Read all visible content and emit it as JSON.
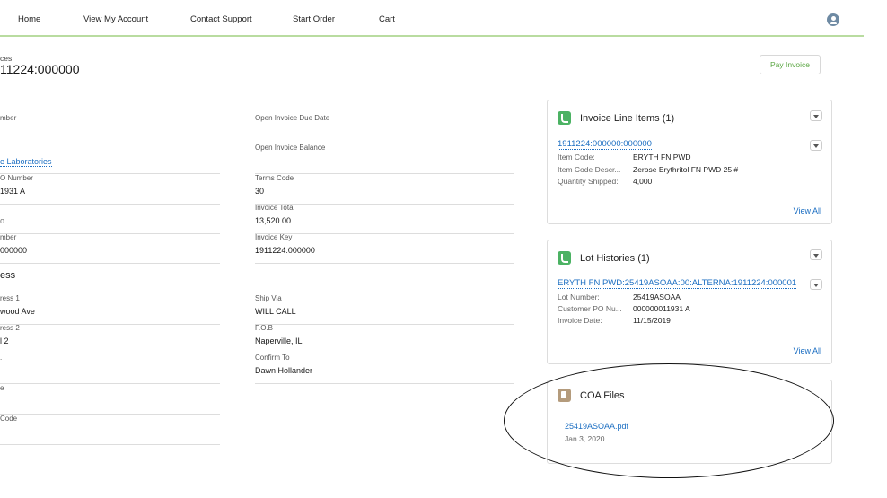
{
  "nav": {
    "items": [
      "Home",
      "View My Account",
      "Contact Support",
      "Start Order",
      "Cart"
    ],
    "avatar_icon": "user-avatar-icon"
  },
  "header": {
    "breadcrumb": "ces",
    "title": "11224:000000",
    "pay_button": "Pay Invoice"
  },
  "left_fields": [
    {
      "label": "mber",
      "value": ""
    },
    {
      "label": "",
      "value": "e Laboratories",
      "link": true
    },
    {
      "label": "O Number",
      "value": "1931 A"
    },
    {
      "label": "",
      "value": "o"
    },
    {
      "label": "mber",
      "value": "000000"
    }
  ],
  "right_fields": [
    {
      "label": "Open Invoice Due Date",
      "value": ""
    },
    {
      "label": "Open Invoice Balance",
      "value": ""
    },
    {
      "label": "Terms Code",
      "value": "30"
    },
    {
      "label": "Invoice Total",
      "value": "13,520.00"
    },
    {
      "label": "Invoice Key",
      "value": "1911224:000000"
    }
  ],
  "section_title": "ess",
  "left_fields2": [
    {
      "label": "ress 1",
      "value": "wood Ave"
    },
    {
      "label": "ress 2",
      "value": "l 2"
    },
    {
      "label": ".",
      "value": ""
    },
    {
      "label": "e",
      "value": ""
    },
    {
      "label": "Code",
      "value": ""
    }
  ],
  "right_fields2": [
    {
      "label": "Ship Via",
      "value": "WILL CALL"
    },
    {
      "label": "F.O.B",
      "value": "Naperville, IL"
    },
    {
      "label": "Confirm To",
      "value": "Dawn Hollander"
    }
  ],
  "line_items": {
    "title": "Invoice Line Items (1)",
    "record": "1911224:000000:000000",
    "rows": [
      [
        "Item Code:",
        "ERYTH FN PWD"
      ],
      [
        "Item Code Descr...",
        "Zerose Erythritol FN PWD 25 #"
      ],
      [
        "Quantity Shipped:",
        "4,000"
      ]
    ],
    "view_all": "View All"
  },
  "lot_histories": {
    "title": "Lot Histories (1)",
    "record": "ERYTH FN PWD:25419ASOAA:00:ALTERNA:1911224:000001",
    "rows": [
      [
        "Lot Number:",
        "25419ASOAA"
      ],
      [
        "Customer PO Nu...",
        "000000011931 A"
      ],
      [
        "Invoice Date:",
        "11/15/2019"
      ]
    ],
    "view_all": "View All"
  },
  "coa_files": {
    "title": "COA Files",
    "file_name": "25419ASOAA.pdf",
    "file_date": "Jan 3, 2020"
  },
  "colors": {
    "accent_green": "#5aa642",
    "link_blue": "#1b6ec2",
    "nav_border": "#b9dca0"
  }
}
